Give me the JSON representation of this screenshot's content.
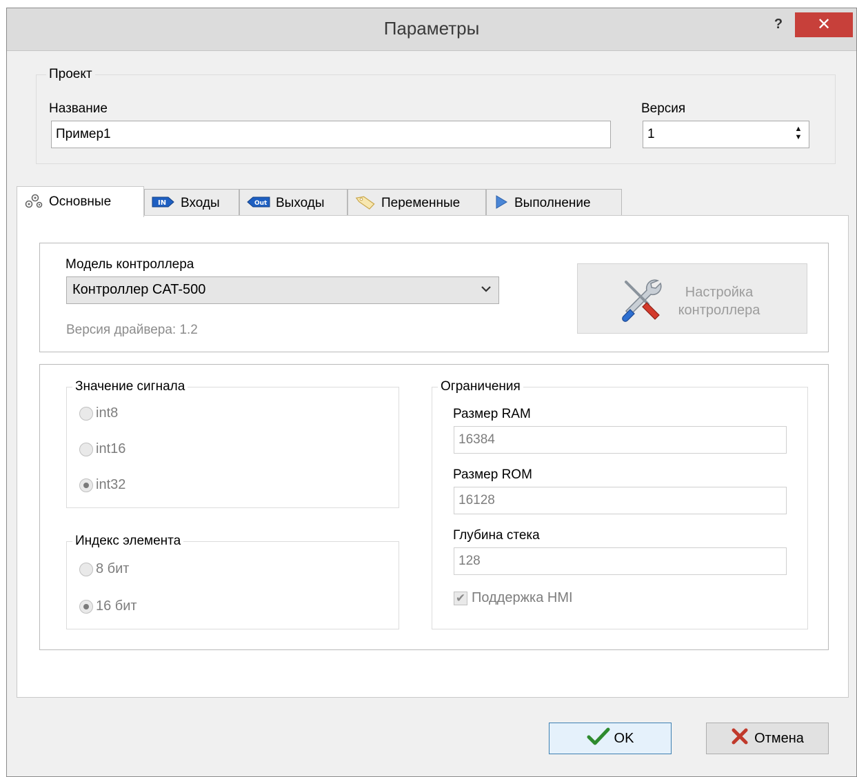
{
  "window": {
    "title": "Параметры",
    "help_label": "?",
    "close_label": "✕"
  },
  "project": {
    "group_title": "Проект",
    "name_label": "Название",
    "name_value": "Пример1",
    "version_label": "Версия",
    "version_value": "1"
  },
  "tabs": [
    {
      "label": "Основные",
      "icon": "gears-icon",
      "active": true
    },
    {
      "label": "Входы",
      "icon": "in-badge-icon"
    },
    {
      "label": "Выходы",
      "icon": "out-badge-icon"
    },
    {
      "label": "Переменные",
      "icon": "tag-icon"
    },
    {
      "label": "Выполнение",
      "icon": "play-icon"
    }
  ],
  "icon_badges": {
    "in": "IN",
    "out": "Out"
  },
  "controller": {
    "model_label": "Модель контроллера",
    "model_value": "Контроллер CAT-500",
    "driver_version": "Версия драйвера: 1.2",
    "config_button_line1": "Настройка",
    "config_button_line2": "контроллера"
  },
  "signal": {
    "group_title": "Значение сигнала",
    "options": [
      "int8",
      "int16",
      "int32"
    ],
    "selected": "int32"
  },
  "index": {
    "group_title": "Индекс элемента",
    "options": [
      "8 бит",
      "16 бит"
    ],
    "selected": "16 бит"
  },
  "limits": {
    "group_title": "Ограничения",
    "ram_label": "Размер RAM",
    "ram_value": "16384",
    "rom_label": "Размер ROM",
    "rom_value": "16128",
    "stack_label": "Глубина стека",
    "stack_value": "128",
    "hmi_label": "Поддержка HMI",
    "hmi_checked": true
  },
  "footer": {
    "ok_label": "OK",
    "cancel_label": "Отмена"
  },
  "colors": {
    "close_red": "#c7403a",
    "ok_check_green": "#2e8b2e",
    "cancel_x_red": "#c0392b",
    "accent_blue": "#1e5fc1"
  }
}
